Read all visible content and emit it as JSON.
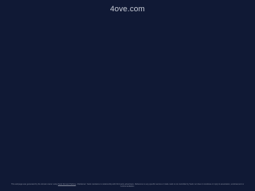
{
  "header": {
    "domain": "4ove.com"
  },
  "footer": {
    "text_before_link": "This webpage was generated by the domain owner using",
    "link_label": "Sedo Domain Parking",
    "text_after_link": ". Disclaimer: Sedo maintains no relationship with third party advertisers. Reference to any specific service or trade mark is not controlled by Sedo nor does it constitute or imply its association, endorsement or recommendation."
  }
}
